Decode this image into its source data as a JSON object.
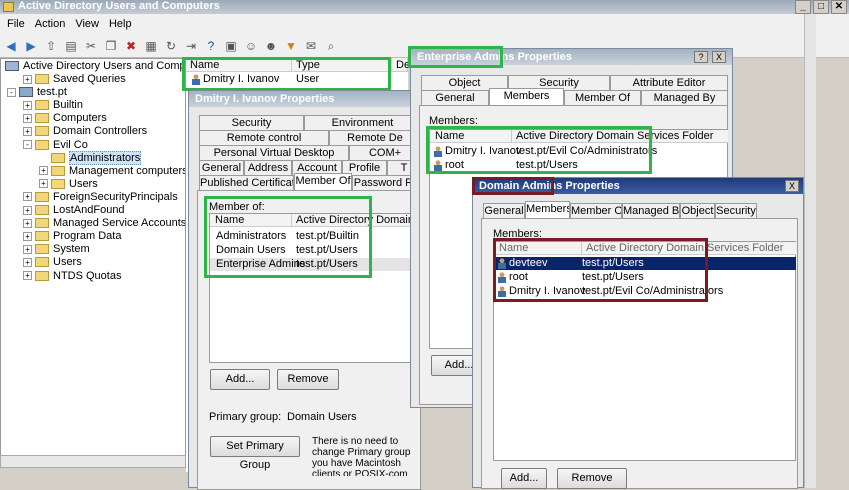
{
  "window": {
    "title": "Active Directory Users and Computers"
  },
  "menu": [
    "File",
    "Action",
    "View",
    "Help"
  ],
  "toolbar": [
    "back-icon",
    "forward-icon",
    "up-icon",
    "view-icon",
    "cut-icon",
    "copy-icon",
    "delete-icon",
    "properties-icon",
    "refresh-icon",
    "export-icon",
    "help-icon",
    "console-icon",
    "add-user-icon",
    "add-group-icon",
    "filter-icon",
    "delegate-icon",
    "find-icon"
  ],
  "tree": {
    "root": "Active Directory Users and Computers [W",
    "items": [
      {
        "label": "Saved Queries",
        "level": 1,
        "exp": "+"
      },
      {
        "label": "test.pt",
        "level": 0,
        "exp": "-"
      },
      {
        "label": "Builtin",
        "level": 1,
        "exp": "+"
      },
      {
        "label": "Computers",
        "level": 1,
        "exp": "+"
      },
      {
        "label": "Domain Controllers",
        "level": 1,
        "exp": "+"
      },
      {
        "label": "Evil Co",
        "level": 1,
        "exp": "-"
      },
      {
        "label": "Administrators",
        "level": 2,
        "exp": "",
        "selected": true
      },
      {
        "label": "Management computers",
        "level": 2,
        "exp": "+"
      },
      {
        "label": "Users",
        "level": 2,
        "exp": "+"
      },
      {
        "label": "ForeignSecurityPrincipals",
        "level": 1,
        "exp": "+"
      },
      {
        "label": "LostAndFound",
        "level": 1,
        "exp": "+"
      },
      {
        "label": "Managed Service Accounts",
        "level": 1,
        "exp": "+"
      },
      {
        "label": "Program Data",
        "level": 1,
        "exp": "+"
      },
      {
        "label": "System",
        "level": 1,
        "exp": "+"
      },
      {
        "label": "Users",
        "level": 1,
        "exp": "+"
      },
      {
        "label": "NTDS Quotas",
        "level": 1,
        "exp": "+"
      }
    ]
  },
  "list": {
    "headers": [
      "Name",
      "Type",
      "De"
    ],
    "rows": [
      {
        "name": "Dmitry I. Ivanov",
        "type": "User"
      }
    ]
  },
  "dmitry_dialog": {
    "title": "Dmitry I. Ivanov Properties",
    "tabs_row1": [
      "Security",
      "Environment"
    ],
    "tabs_row2": [
      "Remote control",
      "Remote De"
    ],
    "tabs_row3": [
      "Personal Virtual Desktop",
      "COM+"
    ],
    "tabs_row4": [
      "General",
      "Address",
      "Account",
      "Profile",
      "T"
    ],
    "tabs_row5": [
      "Published Certificates",
      "Member Of",
      "Password Re"
    ],
    "member_of_label": "Member of:",
    "headers": [
      "Name",
      "Active Directory Domain Serv"
    ],
    "rows": [
      {
        "name": "Administrators",
        "folder": "test.pt/Builtin"
      },
      {
        "name": "Domain Users",
        "folder": "test.pt/Users"
      },
      {
        "name": "Enterprise Admins",
        "folder": "test.pt/Users"
      }
    ],
    "add": "Add...",
    "remove": "Remove",
    "primary_group_label": "Primary group:",
    "primary_group_value": "Domain Users",
    "set_primary": "Set Primary Group",
    "note": "There is no need to change Primary group you have Macintosh clients or POSIX-com applications."
  },
  "ea_dialog": {
    "title_hl": "Enterprise Admins",
    "title_rest": " Properties",
    "help": "?",
    "close": "X",
    "tabs_row1": [
      "Object",
      "Security",
      "Attribute Editor"
    ],
    "tabs_row2": [
      "General",
      "Members",
      "Member Of",
      "Managed By"
    ],
    "members_label": "Members:",
    "headers": [
      "Name",
      "Active Directory Domain Services Folder"
    ],
    "rows": [
      {
        "name": "Dmitry I. Ivanov",
        "folder": "test.pt/Evil Co/Administrators"
      },
      {
        "name": "root",
        "folder": "test.pt/Users"
      }
    ],
    "add": "Add..."
  },
  "da_dialog": {
    "title_hl": "Domain Admins",
    "title_rest": " Properties",
    "close": "X",
    "tabs": [
      "General",
      "Members",
      "Member Of",
      "Managed By",
      "Object",
      "Security"
    ],
    "members_label": "Members:",
    "headers": [
      "Name",
      "Active Directory Domain Services Folder"
    ],
    "rows": [
      {
        "name": "devteev",
        "folder": "test.pt/Users",
        "selected": true
      },
      {
        "name": "root",
        "folder": "test.pt/Users"
      },
      {
        "name": "Dmitry I. Ivanov",
        "folder": "test.pt/Evil Co/Administrators"
      }
    ],
    "add": "Add...",
    "remove": "Remove"
  }
}
